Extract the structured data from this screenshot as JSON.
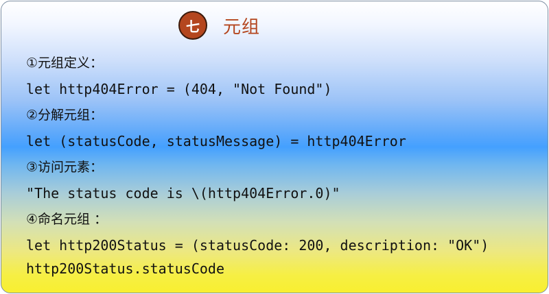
{
  "header": {
    "badge": "七",
    "title": "元组"
  },
  "sections": [
    {
      "label": "①元组定义：",
      "code": [
        "let http404Error = (404, \"Not Found\")"
      ]
    },
    {
      "label": "②分解元组：",
      "code": [
        "let (statusCode, statusMessage) = http404Error"
      ]
    },
    {
      "label": "③访问元素：",
      "code": [
        "\"The status code is \\(http404Error.0)\""
      ]
    },
    {
      "label": "④命名元组 ：",
      "code": [
        "let http200Status = (statusCode: 200, description: \"OK\")",
        "http200Status.statusCode"
      ]
    }
  ],
  "colors": {
    "accent": "#b4461e",
    "gradient_top": "#ffffff",
    "gradient_mid": "#44a0ff",
    "gradient_bottom": "#f8ef30"
  }
}
